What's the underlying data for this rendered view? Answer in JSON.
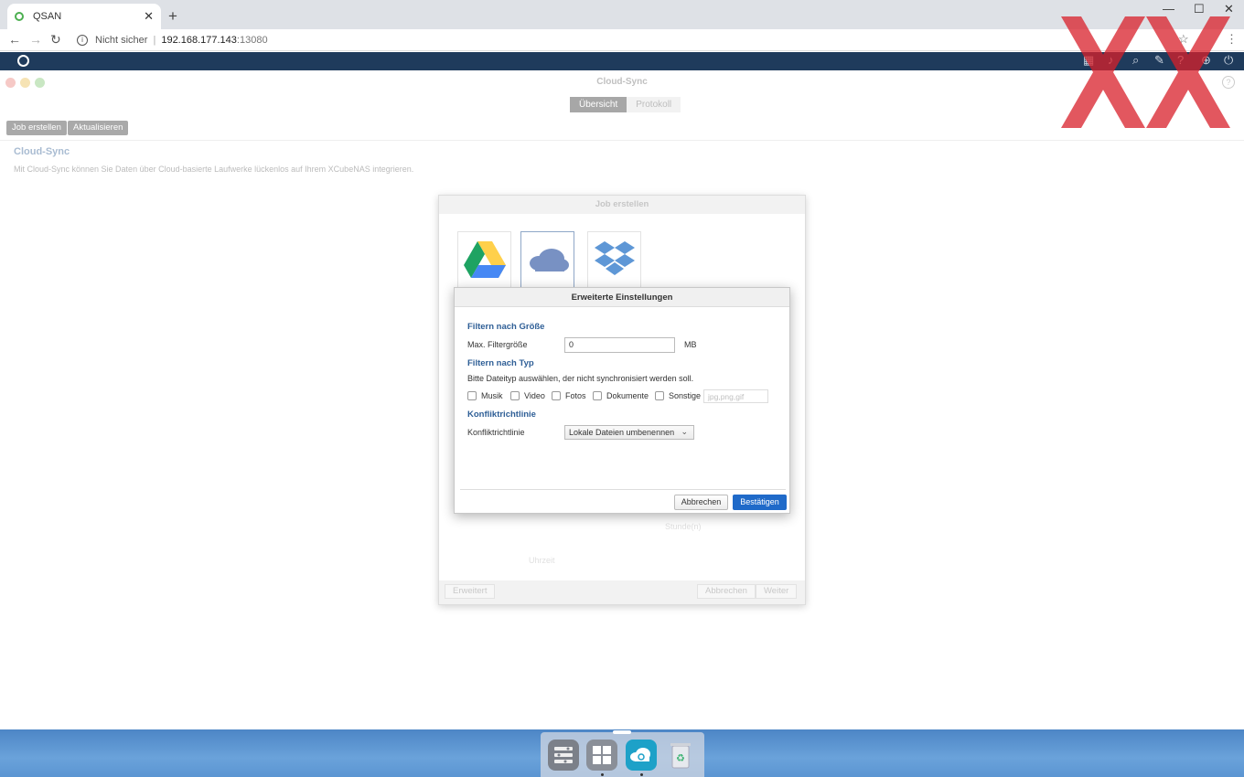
{
  "browser": {
    "tab_title": "QSAN",
    "new_tab": "+",
    "not_secure": "Nicht sicher",
    "separator": "|",
    "host": "192.168.177.143",
    "port": ":13080"
  },
  "app": {
    "title": "Cloud-Sync",
    "tabs": [
      "Übersicht",
      "Protokoll"
    ],
    "actions": {
      "create": "Job erstellen",
      "refresh": "Aktualisieren"
    },
    "section_title": "Cloud-Sync",
    "description": "Mit Cloud-Sync können Sie Daten über Cloud-basierte Laufwerke lückenlos auf Ihrem XCubeNAS integrieren."
  },
  "job_dialog": {
    "title": "Job erstellen",
    "providers": [
      "google-drive",
      "onedrive",
      "dropbox"
    ],
    "ghost_unit": "Stunde(n)",
    "ghost_time": "Uhrzeit",
    "buttons": {
      "advanced": "Erweitert",
      "cancel": "Abbrechen",
      "next": "Weiter"
    }
  },
  "advanced_dialog": {
    "title": "Erweiterte Einstellungen",
    "size_filter_heading": "Filtern nach Größe",
    "max_size_label": "Max. Filtergröße",
    "max_size_value": "0",
    "max_size_unit": "MB",
    "type_filter_heading": "Filtern nach Typ",
    "type_filter_hint": "Bitte Dateityp auswählen, der nicht synchronisiert werden soll.",
    "types": [
      {
        "label": "Musik",
        "checked": false
      },
      {
        "label": "Video",
        "checked": false
      },
      {
        "label": "Fotos",
        "checked": false
      },
      {
        "label": "Dokumente",
        "checked": false
      },
      {
        "label": "Sonstige",
        "checked": false
      }
    ],
    "other_placeholder": "jpg,png,gif",
    "conflict_heading": "Konfliktrichtlinie",
    "conflict_label": "Konfliktrichtlinie",
    "conflict_value": "Lokale Dateien umbenennen",
    "cancel": "Abbrechen",
    "confirm": "Bestätigen"
  },
  "colors": {
    "accent": "#1f6ac9",
    "heading": "#2e5e96",
    "qsan_bar": "#1f3b5c"
  }
}
